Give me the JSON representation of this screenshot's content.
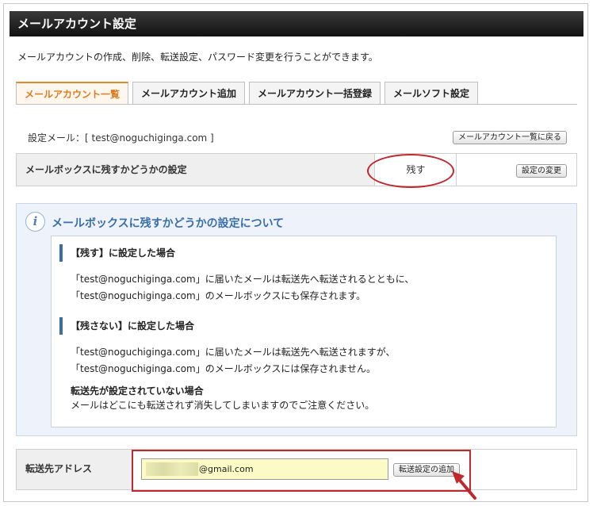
{
  "header": {
    "title": "メールアカウント設定"
  },
  "description": "メールアカウントの作成、削除、転送設定、パスワード変更を行うことができます。",
  "tabs": [
    {
      "label": "メールアカウント一覧",
      "active": true
    },
    {
      "label": "メールアカウント追加",
      "active": false
    },
    {
      "label": "メールアカウント一括登録",
      "active": false
    },
    {
      "label": "メールソフト設定",
      "active": false
    }
  ],
  "setting_mail": {
    "text": "設定メール：[ test@noguchiginga.com ]",
    "back_button": "メールアカウント一覧に戻る"
  },
  "mailbox_setting": {
    "label": "メールボックスに残すかどうかの設定",
    "value": "残す",
    "change_button": "設定の変更"
  },
  "info": {
    "title": "メールボックスに残すかどうかの設定について",
    "sections": [
      {
        "heading": "【残す】に設定した場合",
        "lines": [
          "「test@noguchiginga.com」に届いたメールは転送先へ転送されるとともに、",
          "「test@noguchiginga.com」のメールボックスにも保存されます。"
        ]
      },
      {
        "heading": "【残さない】に設定した場合",
        "lines": [
          "「test@noguchiginga.com」に届いたメールは転送先へ転送されますが、",
          "「test@noguchiginga.com」のメールボックスには保存されません。"
        ]
      }
    ],
    "note_title": "転送先が設定されていない場合",
    "note_text": "メールはどこにも転送されず消失してしまいますのでご注意ください。"
  },
  "forward": {
    "label": "転送先アドレス",
    "value": "@gmail.com",
    "add_button": "転送設定の追加"
  },
  "colors": {
    "highlight_red": "#c0282d",
    "active_tab": "#e07a1f",
    "info_title": "#3a6ea8",
    "input_bg": "#fcfbc6"
  }
}
